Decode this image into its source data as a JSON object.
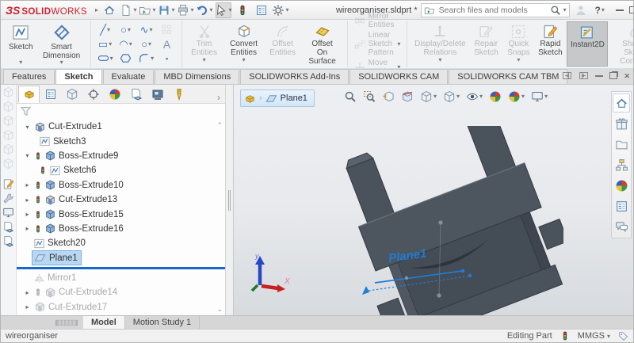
{
  "titlebar": {
    "logo_mark": "ЗS",
    "logo_text_bold": "SOLID",
    "logo_text_light": "WORKS",
    "document_title": "wireorganiser.sldprt *",
    "search_placeholder": "Search files and models",
    "help_label": "?"
  },
  "ribbon": {
    "sketch": "Sketch",
    "smart_dimension": "Smart Dimension",
    "text_tool": "A",
    "trim_entities": "Trim Entities",
    "convert_entities": "Convert Entities",
    "offset_entities": "Offset Entities",
    "offset_on_surface": "Offset On Surface",
    "mirror_entities": "Mirror Entities",
    "linear_sketch_pattern": "Linear Sketch Pattern",
    "move_entities": "Move Entities",
    "display_delete_relations": "Display/Delete Relations",
    "repair_sketch": "Repair Sketch",
    "quick_snaps": "Quick Snaps",
    "rapid_sketch": "Rapid Sketch",
    "instant2d": "Instant2D",
    "shaded_sketch_contours": "Shaded Sketch Contours"
  },
  "command_tabs": {
    "active": "Sketch",
    "items": [
      {
        "label": "Features"
      },
      {
        "label": "Sketch"
      },
      {
        "label": "Evaluate"
      },
      {
        "label": "MBD Dimensions"
      },
      {
        "label": "SOLIDWORKS Add-Ins"
      },
      {
        "label": "SOLIDWORKS CAM"
      },
      {
        "label": "SOLIDWORKS CAM TBM"
      }
    ]
  },
  "feature_tree": {
    "items": [
      {
        "label": "Cut-Extrude1",
        "state": "expanded"
      },
      {
        "label": "Sketch3",
        "state": "child"
      },
      {
        "label": "Boss-Extrude9",
        "state": "expanded"
      },
      {
        "label": "Sketch6",
        "state": "child"
      },
      {
        "label": "Boss-Extrude10",
        "state": "collapsed"
      },
      {
        "label": "Cut-Extrude13",
        "state": "collapsed"
      },
      {
        "label": "Boss-Extrude15",
        "state": "collapsed"
      },
      {
        "label": "Boss-Extrude16",
        "state": "collapsed"
      },
      {
        "label": "Sketch20",
        "state": "leaf"
      },
      {
        "label": "Plane1",
        "state": "selected"
      },
      {
        "label": "Mirror1",
        "state": "rolled-back"
      },
      {
        "label": "Cut-Extrude14",
        "state": "rolled-back"
      },
      {
        "label": "Cut-Extrude17",
        "state": "rolled-back"
      }
    ]
  },
  "viewport": {
    "breadcrumb_label": "Plane1",
    "plane_label": "Plane1",
    "triad_x": "X",
    "triad_y": "y"
  },
  "bottom_tabs": {
    "model": "Model",
    "motion_study": "Motion Study 1"
  },
  "statusbar": {
    "document": "wireorganiser",
    "mode": "Editing Part",
    "units": "MMGS"
  },
  "colors": {
    "accent_blue": "#1f7cd6",
    "logo_red": "#cf2030",
    "model_gray": "#4a525b",
    "selection_blue": "#b8d7f2",
    "rollback_bar": "#1569c7"
  },
  "icons": {
    "dropdown": "▾",
    "expand_open": "▾",
    "expand_closed": "▸",
    "chevron_right": "›",
    "close": "×",
    "scroll_up": "⌃",
    "scroll_down": "⌄"
  }
}
